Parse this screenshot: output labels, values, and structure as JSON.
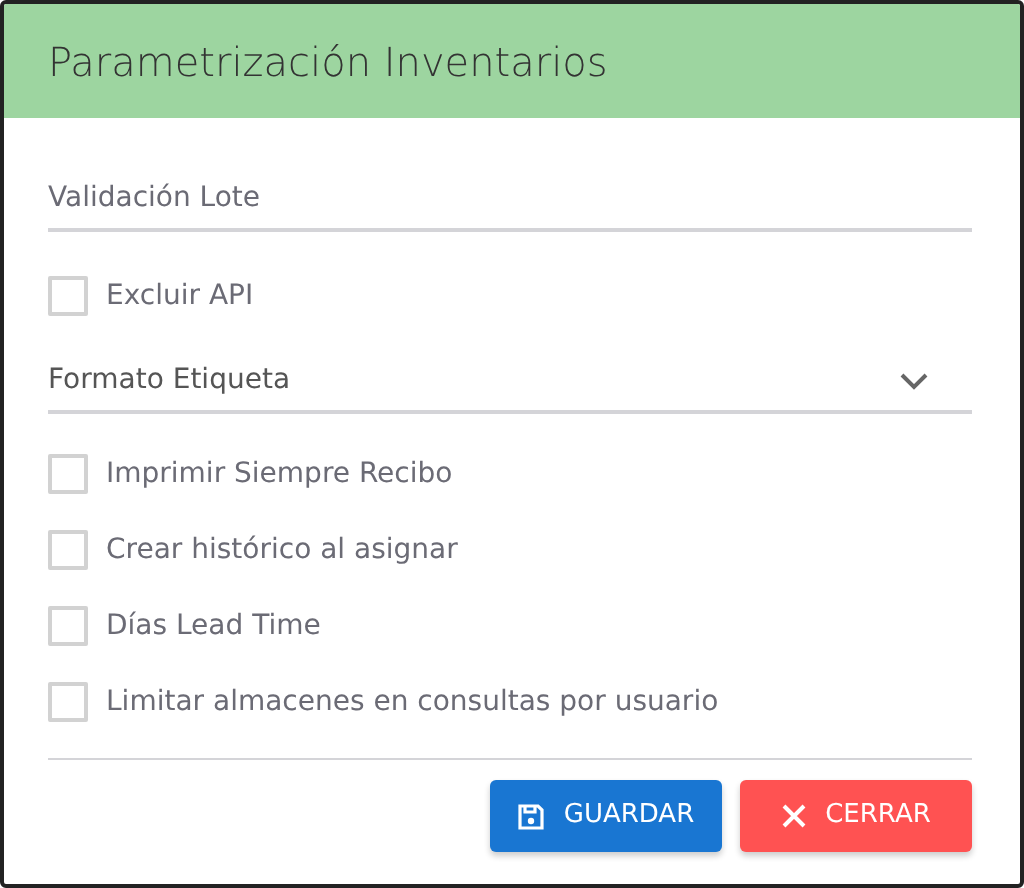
{
  "dialog": {
    "title": "Parametrización Inventarios"
  },
  "fields": [
    {
      "kind": "text",
      "placeholder": "Validación Lote"
    },
    {
      "kind": "checkbox",
      "label": "Excluir API",
      "checked": false
    },
    {
      "kind": "select",
      "placeholder": "Formato Etiqueta"
    },
    {
      "kind": "checkbox",
      "label": "Imprimir Siempre Recibo",
      "checked": false
    },
    {
      "kind": "checkbox",
      "label": "Crear histórico al asignar",
      "checked": false
    },
    {
      "kind": "checkbox",
      "label": "Días Lead Time",
      "checked": false
    },
    {
      "kind": "checkbox",
      "label": "Limitar almacenes en consultas por usuario",
      "checked": false
    }
  ],
  "buttons": [
    {
      "kind": "save",
      "label": "GUARDAR"
    },
    {
      "kind": "close",
      "label": "CERRAR"
    }
  ]
}
